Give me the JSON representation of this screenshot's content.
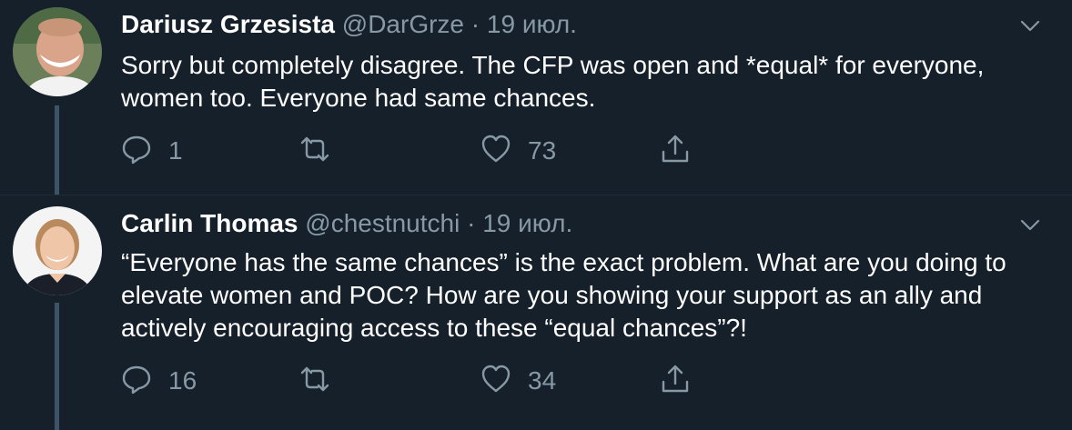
{
  "tweets": [
    {
      "display_name": "Dariusz Grzesista",
      "handle": "@DarGrze",
      "separator": "·",
      "date": "19 июл.",
      "text": "Sorry but completely disagree. The CFP was open and *equal* for everyone, women too. Everyone had same chances.",
      "replies": "1",
      "retweets": "",
      "likes": "73"
    },
    {
      "display_name": "Carlin Thomas",
      "handle": "@chestnutchi",
      "separator": "·",
      "date": "19 июл.",
      "text": "“Everyone has the same chances” is the exact problem. What are you doing to elevate women and POC? How are you showing your support as an ally and actively encouraging access to these “equal chances”?!",
      "replies": "16",
      "retweets": "",
      "likes": "34"
    }
  ],
  "colors": {
    "background": "#15202b",
    "text": "#ffffff",
    "secondary": "#8899a6",
    "thread_line": "#3d5466"
  },
  "icons": [
    "reply-icon",
    "retweet-icon",
    "like-icon",
    "share-icon",
    "chevron-down-icon"
  ]
}
